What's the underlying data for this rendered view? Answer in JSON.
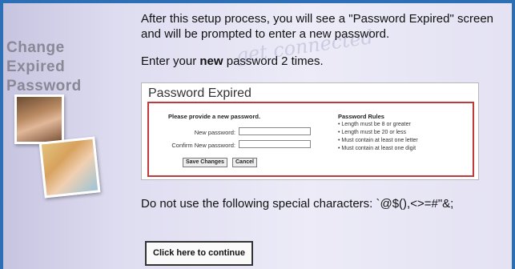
{
  "sidebar": {
    "title_lines": [
      "Change",
      "Expired",
      "Password"
    ]
  },
  "watermark": "get connected",
  "intro_text": "After this setup process, you will see a \"Password Expired\" screen and will be prompted to enter a new password.",
  "enter": {
    "prefix": "Enter your ",
    "emphasis": "new",
    "suffix": " password 2 times."
  },
  "dialog": {
    "title": "Password Expired",
    "prompt": "Please provide a new password.",
    "new_password_label": "New password:",
    "confirm_password_label": "Confirm New password:",
    "new_password_value": "",
    "confirm_password_value": "",
    "save_label": "Save Changes",
    "cancel_label": "Cancel",
    "rules_title": "Password Rules",
    "rules": [
      "Length must be 8 or greater",
      "Length must be 20 or less",
      "Must contain at least one letter",
      "Must contain at least one digit"
    ]
  },
  "special_chars_text": "Do not use the following special characters: `@$(),<>=#\"&;",
  "continue_label": "Click here to continue",
  "colors": {
    "frame": "#2d6fb5",
    "dialog_border": "#c0393b"
  }
}
